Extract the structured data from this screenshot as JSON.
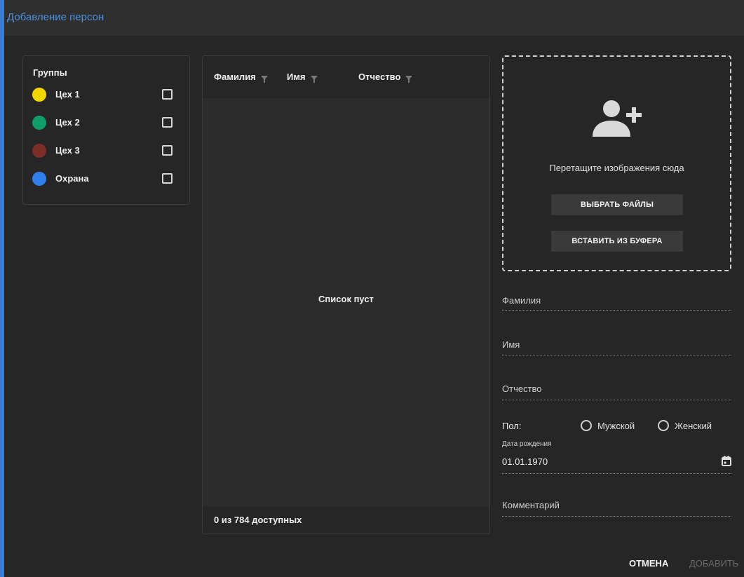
{
  "window": {
    "title": "Добавление персон"
  },
  "groups": {
    "title": "Группы",
    "items": [
      {
        "label": "Цех 1",
        "color": "#f2d600",
        "checked": false
      },
      {
        "label": "Цех 2",
        "color": "#0f9d6b",
        "checked": false
      },
      {
        "label": "Цех 3",
        "color": "#7a2e27",
        "checked": false
      },
      {
        "label": "Охрана",
        "color": "#2f80ed",
        "checked": false
      }
    ]
  },
  "list": {
    "columns": [
      "Фамилия",
      "Имя",
      "Отчество"
    ],
    "empty_text": "Список пуст",
    "footer": "0 из 784 доступных"
  },
  "dropzone": {
    "icon": "add-person-icon",
    "text": "Перетащите изображения сюда",
    "choose_files_label": "ВЫБРАТЬ ФАЙЛЫ",
    "paste_label": "ВСТАВИТЬ ИЗ БУФЕРА"
  },
  "form": {
    "surname_label": "Фамилия",
    "name_label": "Имя",
    "patronymic_label": "Отчество",
    "sex_label": "Пол:",
    "male_label": "Мужской",
    "female_label": "Женский",
    "dob_label": "Дата рождения",
    "dob_value": "01.01.1970",
    "comment_label": "Комментарий"
  },
  "actions": {
    "cancel_label": "ОТМЕНА",
    "add_label": "ДОБАВИТЬ"
  },
  "colors": {
    "accent": "#4a90e2",
    "background": "#262626",
    "disabled_text": "#6a6a6a"
  }
}
